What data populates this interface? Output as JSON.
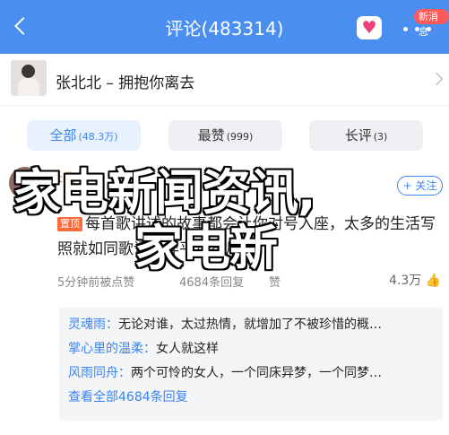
{
  "header": {
    "title": "评论(483314)",
    "new_badge": "新消息"
  },
  "song": {
    "title": "张北北 – 拥抱你离去"
  },
  "tabs": [
    {
      "label": "全部",
      "count": "(48.3万)"
    },
    {
      "label": "最赞",
      "count": "(999)"
    },
    {
      "label": "长评",
      "count": "(3)"
    }
  ],
  "comment": {
    "username": "长北北",
    "follow": "+ 关注",
    "top_tag": "置顶",
    "text": "每首歌讲述的故事都会让你对号入座，太多的生活写照就如同歌词一样平凡岁月！",
    "time": "5分钟前被点赞",
    "reply_count": "4684条回复",
    "like_mid": "赞",
    "likes": "4.3万"
  },
  "replies": [
    {
      "name": "灵魂雨：",
      "text": "无论对谁，太过热情，就增加了不被珍惜的概…"
    },
    {
      "name": "掌心里的温柔：",
      "text": "女人就这样"
    },
    {
      "name": "风雨同舟：",
      "text": "两个可怜的女人，一个同床异梦，一个同梦…"
    }
  ],
  "view_all": "查看全部4684条回复",
  "overlay": {
    "line1": "家电新闻资讯,",
    "line2": "家电新"
  }
}
